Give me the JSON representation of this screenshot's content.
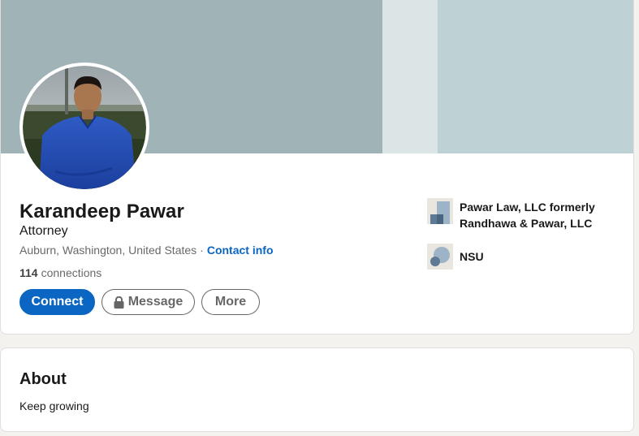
{
  "profile": {
    "name": "Karandeep Pawar",
    "headline": "Attorney",
    "location": "Auburn, Washington, United States",
    "separator": "·",
    "contact_info_label": "Contact info",
    "connections_count": "114",
    "connections_label": "connections",
    "avatar_icon": "profile-photo"
  },
  "actions": {
    "connect_label": "Connect",
    "message_label": "Message",
    "message_icon": "lock-icon",
    "more_label": "More"
  },
  "organizations": [
    {
      "name": "Pawar Law, LLC formerly Randhawa & Pawar, LLC",
      "icon": "company-logo-placeholder"
    },
    {
      "name": "NSU",
      "icon": "school-logo-placeholder"
    }
  ],
  "about": {
    "title": "About",
    "text": "Keep growing"
  },
  "colors": {
    "primary": "#0a66c2",
    "banner": "#a0b4b7",
    "banner_light": "#bed1d4"
  }
}
